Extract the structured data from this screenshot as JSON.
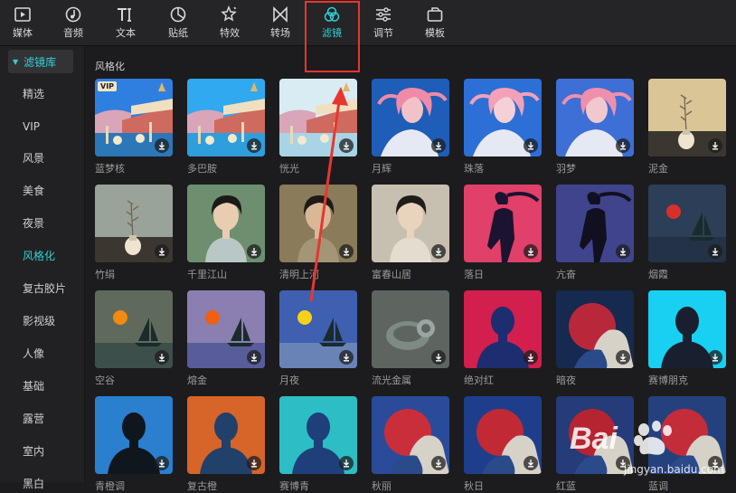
{
  "toolbar": {
    "items": [
      {
        "label": "媒体",
        "icon": "media-icon"
      },
      {
        "label": "音频",
        "icon": "audio-icon"
      },
      {
        "label": "文本",
        "icon": "text-icon"
      },
      {
        "label": "贴纸",
        "icon": "sticker-icon"
      },
      {
        "label": "特效",
        "icon": "effects-icon"
      },
      {
        "label": "转场",
        "icon": "transition-icon"
      },
      {
        "label": "滤镜",
        "icon": "filter-icon"
      },
      {
        "label": "调节",
        "icon": "adjust-icon"
      },
      {
        "label": "模板",
        "icon": "template-icon"
      }
    ],
    "active": "滤镜",
    "accent": "#2fd1d6"
  },
  "sidebar": {
    "header": "滤镜库",
    "items": [
      "精选",
      "VIP",
      "风景",
      "美食",
      "夜景",
      "风格化",
      "复古胶片",
      "影视级",
      "人像",
      "基础",
      "露营",
      "室内",
      "黑白"
    ],
    "active": "风格化"
  },
  "section": {
    "title": "风格化"
  },
  "filters": [
    {
      "name": "蓝梦核",
      "vip": "VIP"
    },
    {
      "name": "多巴胺"
    },
    {
      "name": "恍光"
    },
    {
      "name": "月辉"
    },
    {
      "name": "珠落"
    },
    {
      "name": "羽梦"
    },
    {
      "name": "泥金"
    },
    {
      "name": "竹绢"
    },
    {
      "name": "千里江山"
    },
    {
      "name": "清明上河"
    },
    {
      "name": "富春山居"
    },
    {
      "name": "落日"
    },
    {
      "name": "亢奋"
    },
    {
      "name": "烟霞"
    },
    {
      "name": "空谷"
    },
    {
      "name": "熔金"
    },
    {
      "name": "月夜"
    },
    {
      "name": "流光金属"
    },
    {
      "name": "绝对红"
    },
    {
      "name": "暗夜"
    },
    {
      "name": "赛博朋克"
    },
    {
      "name": "青橙调"
    },
    {
      "name": "复古橙"
    },
    {
      "name": "赛博青"
    },
    {
      "name": "秋丽"
    },
    {
      "name": "秋日"
    },
    {
      "name": "红蓝"
    },
    {
      "name": "蓝调"
    }
  ],
  "watermark": {
    "brand": "Bai经验",
    "url": "jingyan.baidu.com"
  },
  "colors": {
    "highlight": "#e8362f"
  }
}
